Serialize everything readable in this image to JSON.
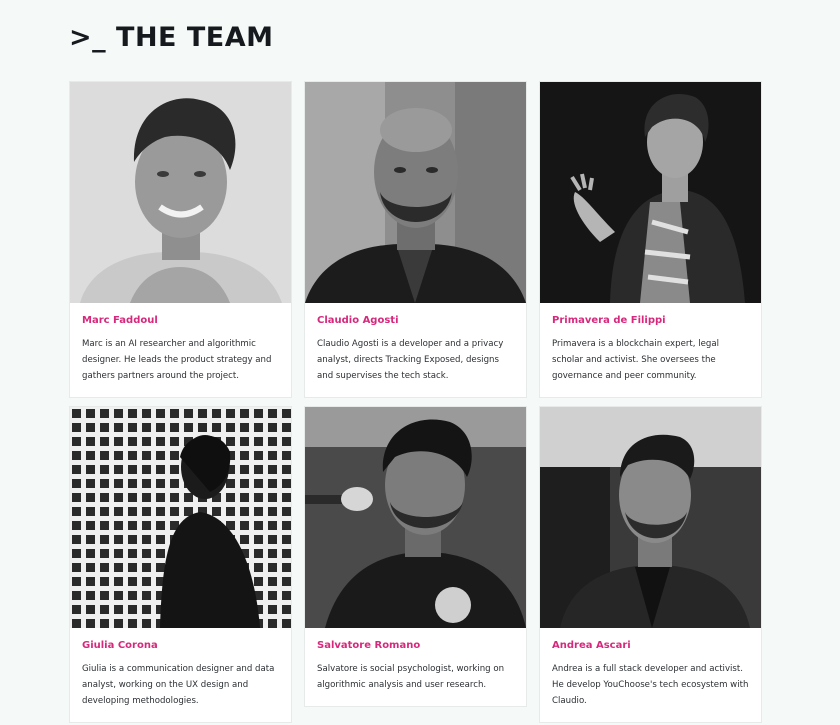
{
  "section": {
    "title": ">_ THE TEAM"
  },
  "members": [
    {
      "name": "Marc Faddoul",
      "bio": "Marc is an AI researcher and algorithmic designer. He leads the product strategy and gathers partners around the project."
    },
    {
      "name": "Claudio Agosti",
      "bio": "Claudio Agosti is a developer and a privacy analyst, directs Tracking Exposed, designs and supervises the tech stack."
    },
    {
      "name": "Primavera de Filippi",
      "bio": "Primavera is a blockchain expert, legal scholar and activist. She oversees the governance and peer community."
    },
    {
      "name": "Giulia Corona",
      "bio": "Giulia is a communication designer and data analyst, working on the UX design and developing methodologies."
    },
    {
      "name": "Salvatore Romano",
      "bio": "Salvatore is social psychologist, working on algorithmic analysis and user research."
    },
    {
      "name": "Andrea Ascari",
      "bio": "Andrea is a full stack developer and activist. He develop YouChoose's tech ecosystem with Claudio."
    }
  ],
  "colors": {
    "accent": "#d6297d",
    "background": "#f5faf8",
    "title": "#161a1e"
  }
}
